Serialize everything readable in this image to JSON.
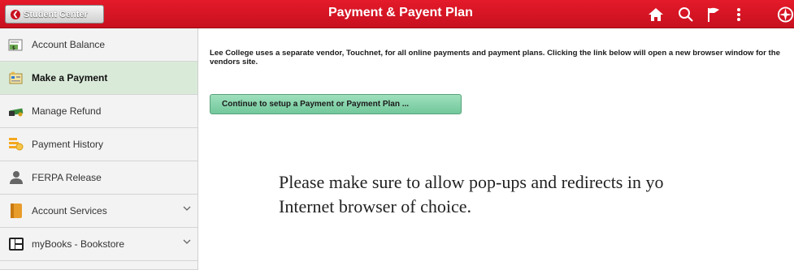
{
  "header": {
    "back_label": "Student Center",
    "title": "Payment & Payent Plan",
    "icons": [
      "home-icon",
      "search-icon",
      "flag-icon",
      "more-vertical-icon",
      "compass-icon"
    ],
    "colors": {
      "bar": "#d41423",
      "text": "#ffffff"
    }
  },
  "sidebar": {
    "items": [
      {
        "label": "Account Balance",
        "icon": "account-balance-icon"
      },
      {
        "label": "Make a Payment",
        "icon": "make-payment-icon",
        "active": true
      },
      {
        "label": "Manage Refund",
        "icon": "manage-refund-icon"
      },
      {
        "label": "Payment History",
        "icon": "payment-history-icon"
      },
      {
        "label": "FERPA Release",
        "icon": "person-icon"
      },
      {
        "label": "Account Services",
        "icon": "account-services-icon",
        "expandable": true
      },
      {
        "label": "myBooks - Bookstore",
        "icon": "books-icon",
        "expandable": true
      }
    ],
    "colors": {
      "active_bg": "#d9ead9"
    }
  },
  "main": {
    "info": "Lee College uses a separate vendor, Touchnet, for all online payments and payment plans. Clicking the link below will open a new browser window for the vendors site.",
    "continue_label": "Continue to setup a Payment or Payment Plan ...",
    "note_line1": "Please make sure to allow pop-ups and redirects in yo",
    "note_line2": "Internet browser of choice."
  }
}
